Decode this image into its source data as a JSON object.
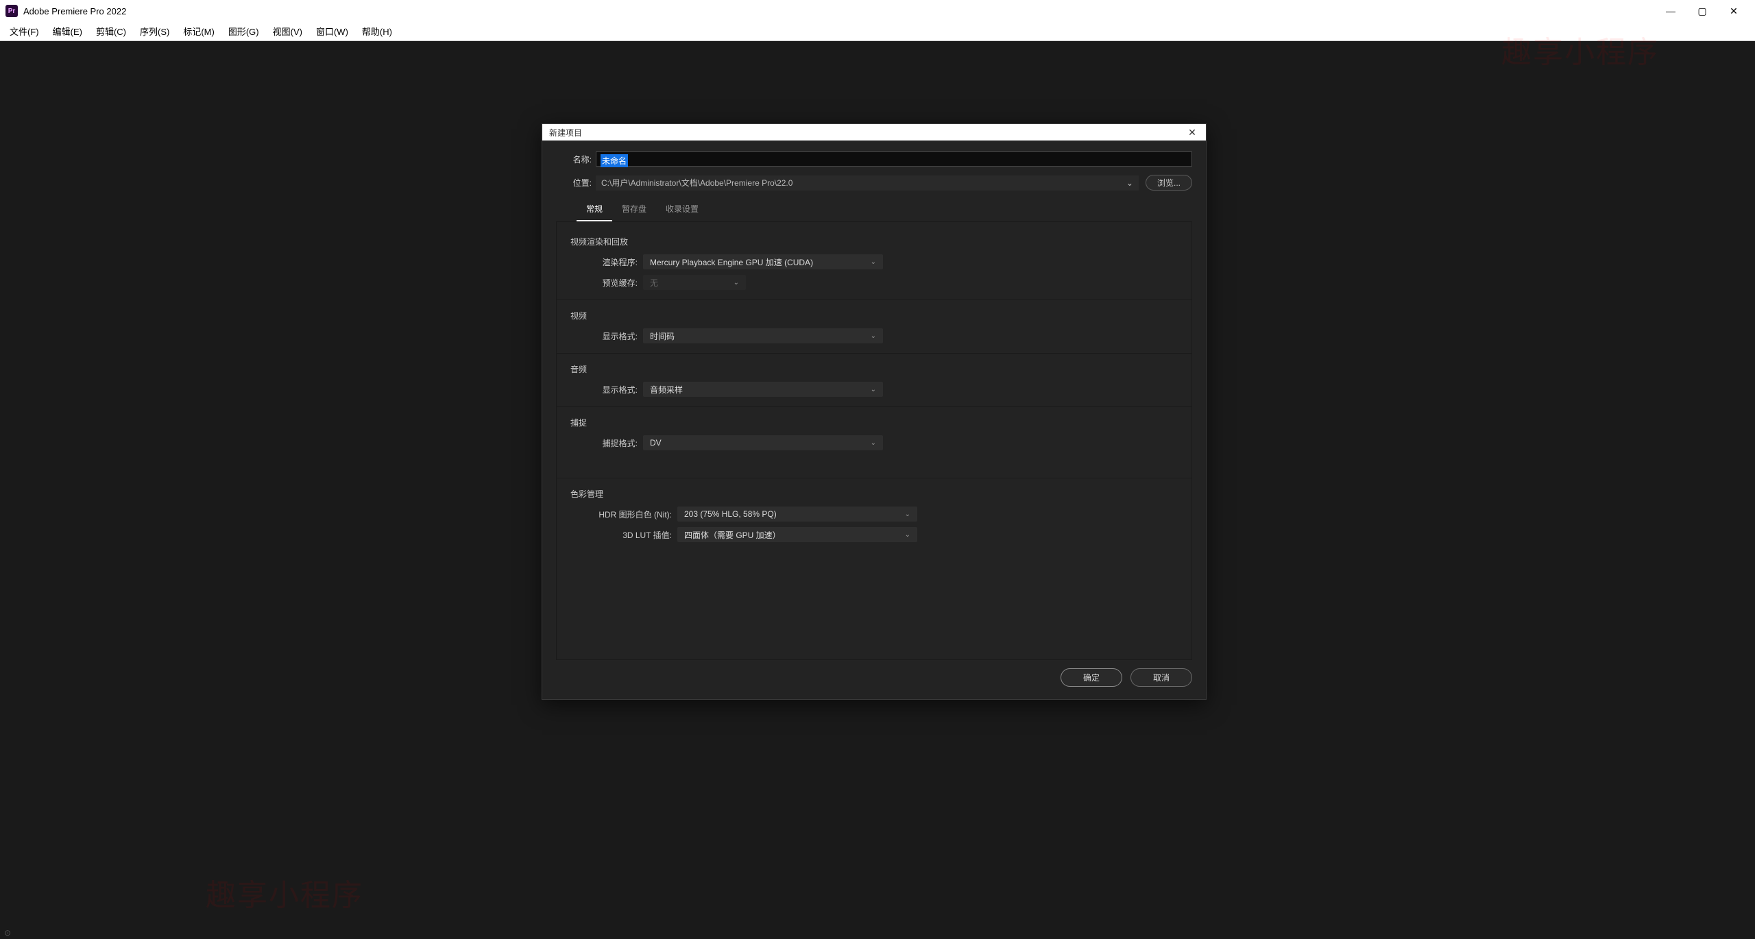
{
  "app": {
    "title": "Adobe Premiere Pro 2022",
    "icon_text": "Pr"
  },
  "menubar": [
    "文件(F)",
    "编辑(E)",
    "剪辑(C)",
    "序列(S)",
    "标记(M)",
    "图形(G)",
    "视图(V)",
    "窗口(W)",
    "帮助(H)"
  ],
  "watermark": "趣享小程序",
  "dialog": {
    "title": "新建项目",
    "name_label": "名称:",
    "name_value": "未命名",
    "location_label": "位置:",
    "location_value": "C:\\用户\\Administrator\\文档\\Adobe\\Premiere Pro\\22.0",
    "browse_label": "浏览...",
    "tabs": [
      "常规",
      "暂存盘",
      "收录设置"
    ],
    "sections": {
      "render": {
        "title": "视频渲染和回放",
        "renderer_label": "渲染程序:",
        "renderer_value": "Mercury Playback Engine GPU 加速 (CUDA)",
        "cache_label": "预览缓存:",
        "cache_value": "无"
      },
      "video": {
        "title": "视频",
        "format_label": "显示格式:",
        "format_value": "时间码"
      },
      "audio": {
        "title": "音频",
        "format_label": "显示格式:",
        "format_value": "音频采样"
      },
      "capture": {
        "title": "捕捉",
        "format_label": "捕捉格式:",
        "format_value": "DV"
      },
      "color": {
        "title": "色彩管理",
        "hdr_label": "HDR 图形白色 (Nit):",
        "hdr_value": "203 (75% HLG, 58% PQ)",
        "lut_label": "3D LUT 插值:",
        "lut_value": "四面体（需要 GPU 加速）"
      }
    },
    "ok_label": "确定",
    "cancel_label": "取消"
  }
}
